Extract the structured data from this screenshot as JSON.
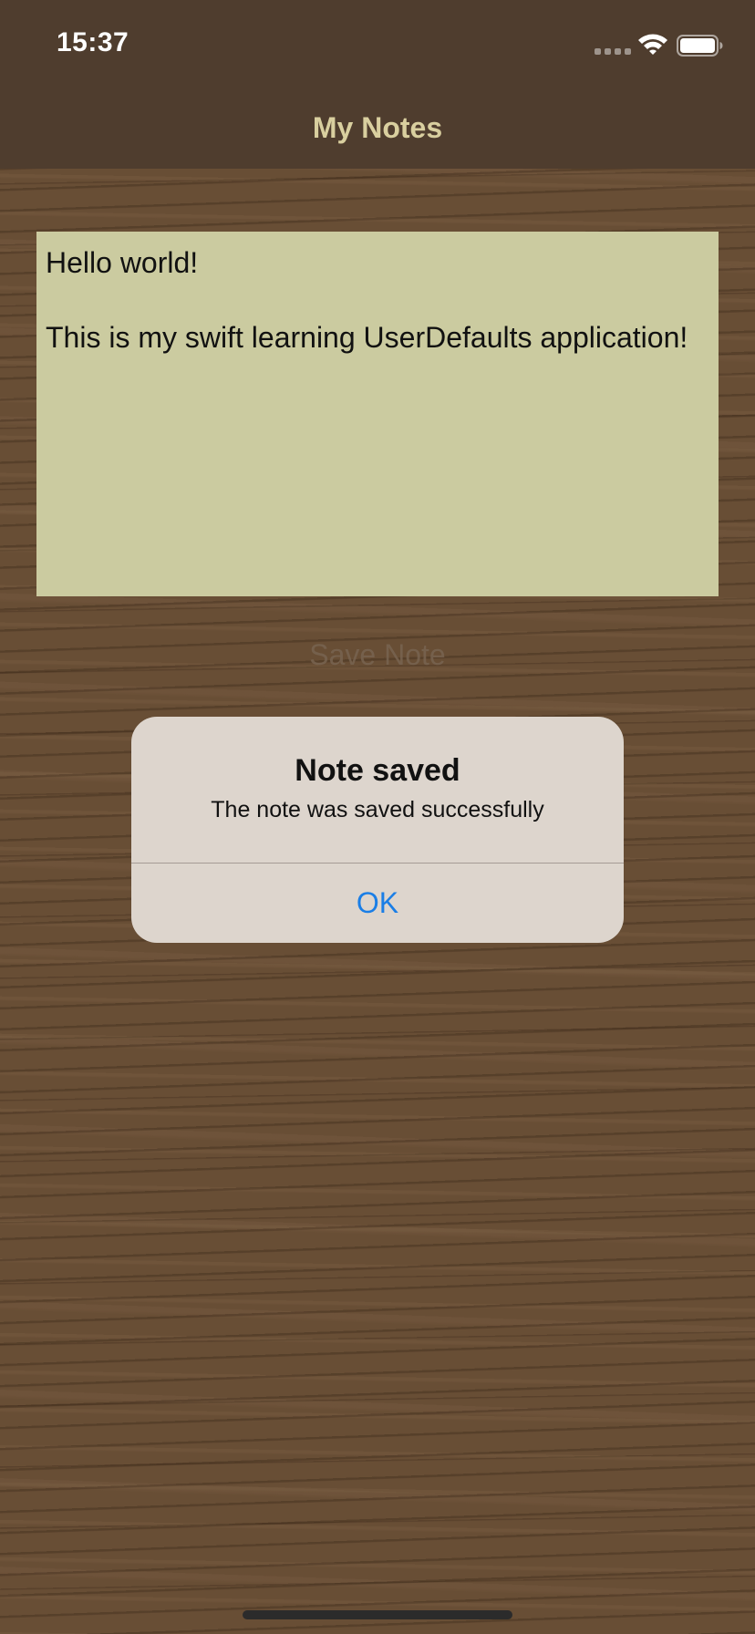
{
  "status_bar": {
    "time": "15:37",
    "signal_icon": "cellular-signal-icon",
    "wifi_icon": "wifi-icon",
    "battery_icon": "battery-icon",
    "battery_level": 1.0
  },
  "nav": {
    "title": "My Notes"
  },
  "note": {
    "text": "Hello world!\n\nThis is my swift learning UserDefaults application!"
  },
  "save_button": {
    "label": "Save Note"
  },
  "alert": {
    "title": "Note saved",
    "message": "The note was saved successfully",
    "ok_label": "OK"
  },
  "colors": {
    "nav_background": "#4f3d2e",
    "nav_title": "#d9cf9f",
    "note_background": "#cbcba0",
    "alert_background": "#ddd5cd",
    "alert_button": "#1a7ee6"
  }
}
